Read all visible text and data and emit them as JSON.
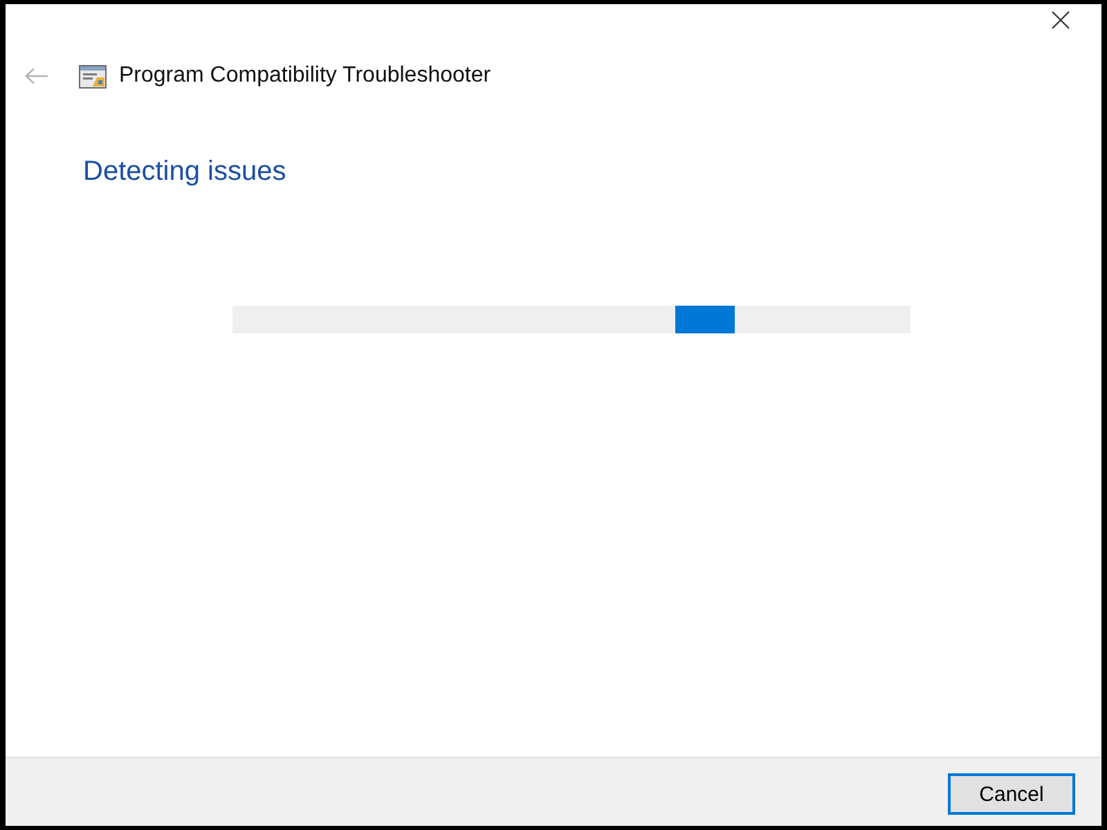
{
  "window": {
    "title": "Program Compatibility Troubleshooter"
  },
  "back_button": {
    "disabled": true
  },
  "heading": "Detecting issues",
  "progress": {
    "level": 0.74
  },
  "buttons": [
    {
      "label": "Cancel",
      "focused": true
    }
  ]
}
